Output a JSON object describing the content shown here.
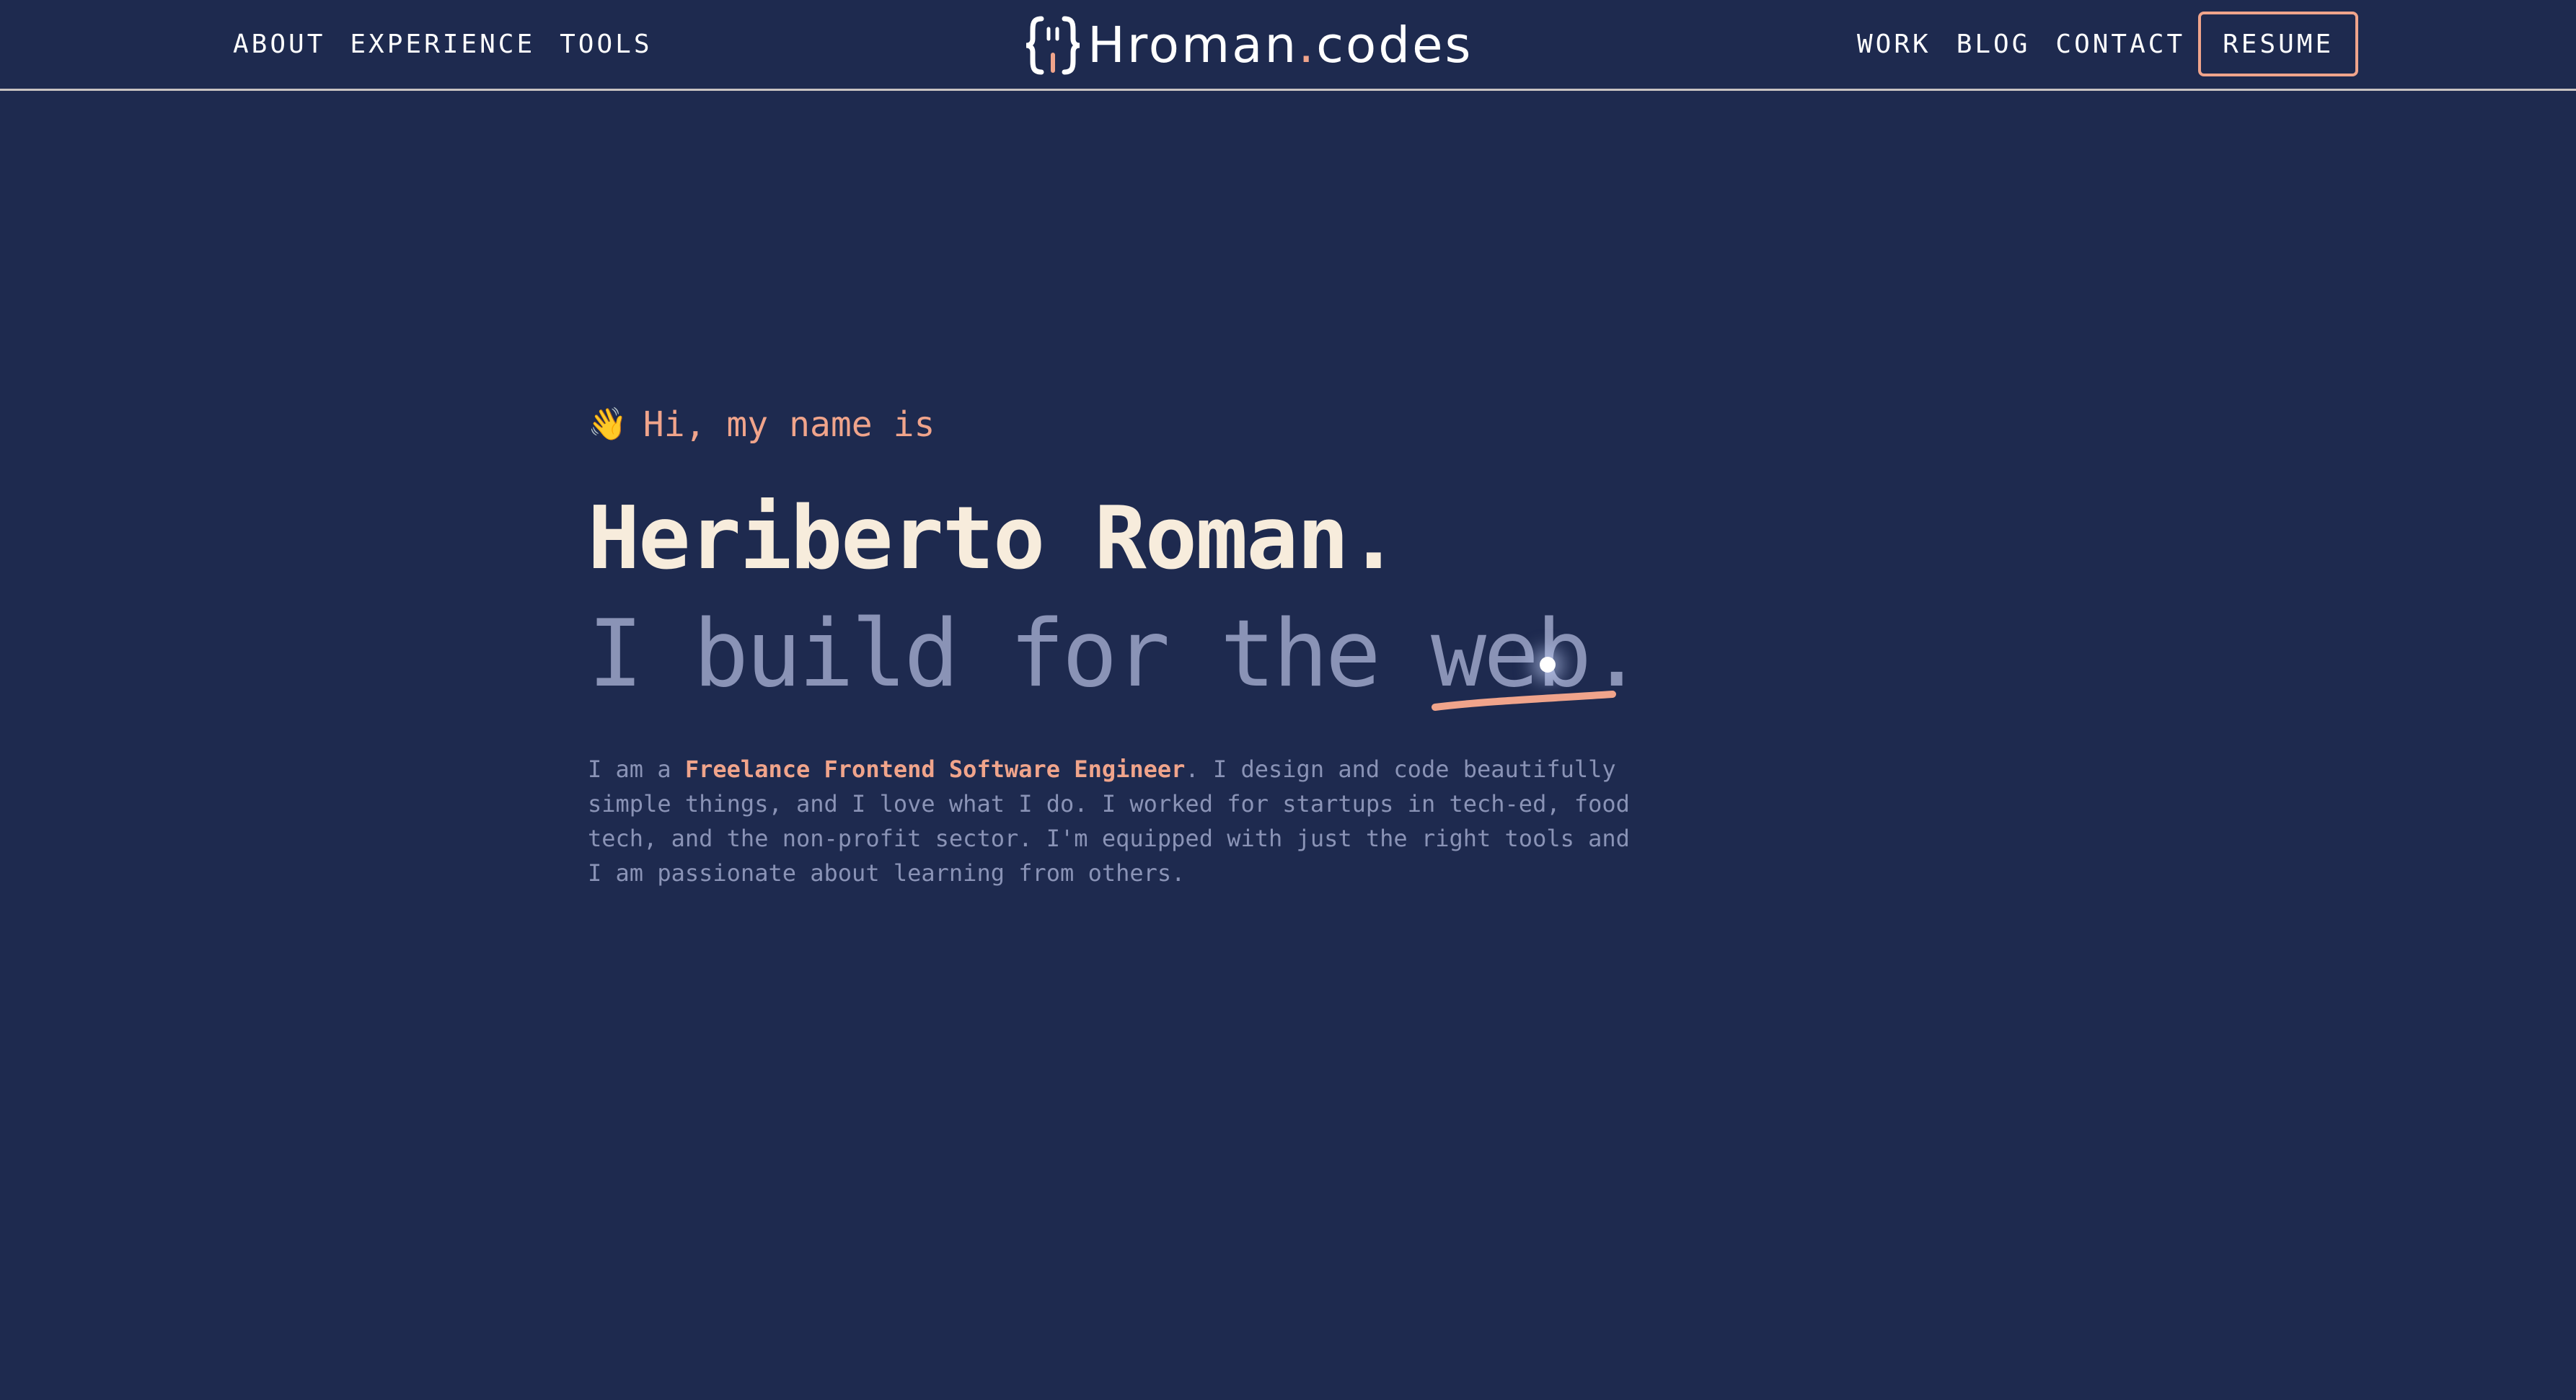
{
  "nav": {
    "left": [
      "ABOUT",
      "EXPERIENCE",
      "TOOLS"
    ],
    "right": [
      "WORK",
      "BLOG",
      "CONTACT"
    ],
    "resume": "RESUME"
  },
  "logo": {
    "name": "Hroman",
    "dot": ".",
    "suffix": "codes",
    "icon": "curly-braces-logo-icon"
  },
  "hero": {
    "wave_icon": "👋",
    "greeting": "Hi, my name is",
    "name": "Heriberto Roman.",
    "tagline_prefix": "I build for the ",
    "tagline_word": "web",
    "tagline_end": ".",
    "bio_prefix": "I am a ",
    "bio_highlight": "Freelance Frontend Software Engineer",
    "bio_rest": ". I design and code beautifully simple things, and I love what I do. I worked for startups in tech-ed, food tech, and the non-profit sector. I'm equipped with just the right tools and I am passionate about learning from others."
  },
  "colors": {
    "background": "#1e2a4f",
    "accent": "#f0a48b",
    "heading": "#f7ecdc",
    "muted": "#8a93b6"
  }
}
